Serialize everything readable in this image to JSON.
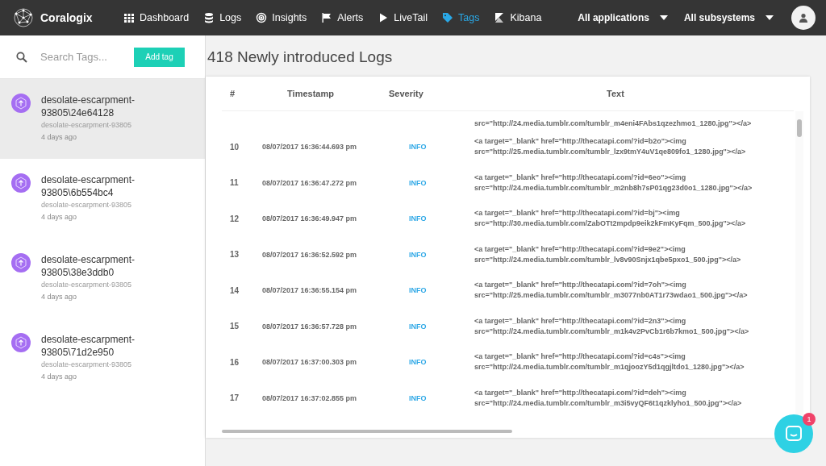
{
  "brand": "Coralogix",
  "nav": [
    {
      "label": "Dashboard",
      "selected": false
    },
    {
      "label": "Logs",
      "selected": false
    },
    {
      "label": "Insights",
      "selected": false
    },
    {
      "label": "Alerts",
      "selected": false
    },
    {
      "label": "LiveTail",
      "selected": false
    },
    {
      "label": "Tags",
      "selected": true
    },
    {
      "label": "Kibana",
      "selected": false
    }
  ],
  "filters": [
    "All applications",
    "All subsystems"
  ],
  "search": {
    "placeholder": "Search Tags..."
  },
  "add_button": "Add tag",
  "tags": [
    {
      "name": "desolate-escarpment-93805\\24e64128",
      "app": "desolate-escarpment-93805",
      "time": "4 days ago",
      "selected": true
    },
    {
      "name": "desolate-escarpment-93805\\6b554bc4",
      "app": "desolate-escarpment-93805",
      "time": "4 days ago",
      "selected": false
    },
    {
      "name": "desolate-escarpment-93805\\38e3ddb0",
      "app": "desolate-escarpment-93805",
      "time": "4 days ago",
      "selected": false
    },
    {
      "name": "desolate-escarpment-93805\\71d2e950",
      "app": "desolate-escarpment-93805",
      "time": "4 days ago",
      "selected": false
    }
  ],
  "title": "418 Newly introduced Logs",
  "table": {
    "columns": [
      "#",
      "Timestamp",
      "Severity",
      "Text"
    ],
    "rows": [
      {
        "text": [
          "src=\"http://24.media.tumblr.com/tumblr_m4eni4FAbs1qzezhmo1_1280.jpg\"></a>"
        ]
      },
      {
        "number": "10",
        "timestamp": "08/07/2017 16:36:44.693 pm",
        "severity": "INFO",
        "text": [
          "<a target=\"_blank\" href=\"http://thecatapi.com/?id=b2o\"><img",
          "src=\"http://25.media.tumblr.com/tumblr_lzx9tmY4uV1qe809fo1_1280.jpg\"></a>"
        ]
      },
      {
        "number": "11",
        "timestamp": "08/07/2017 16:36:47.272 pm",
        "severity": "INFO",
        "text": [
          "<a target=\"_blank\" href=\"http://thecatapi.com/?id=6eo\"><img",
          "src=\"http://24.media.tumblr.com/tumblr_m2nb8h7sP01qg23d0o1_1280.jpg\"></a>"
        ]
      },
      {
        "number": "12",
        "timestamp": "08/07/2017 16:36:49.947 pm",
        "severity": "INFO",
        "text": [
          "<a target=\"_blank\" href=\"http://thecatapi.com/?id=bj\"><img",
          "src=\"http://30.media.tumblr.com/ZabOTt2mpdp9eik2kFmKyFqm_500.jpg\"></a>"
        ]
      },
      {
        "number": "13",
        "timestamp": "08/07/2017 16:36:52.592 pm",
        "severity": "INFO",
        "text": [
          "<a target=\"_blank\" href=\"http://thecatapi.com/?id=9e2\"><img",
          "src=\"http://24.media.tumblr.com/tumblr_lv8v90Snjx1qbe5pxo1_500.jpg\"></a>"
        ]
      },
      {
        "number": "14",
        "timestamp": "08/07/2017 16:36:55.154 pm",
        "severity": "INFO",
        "text": [
          "<a target=\"_blank\" href=\"http://thecatapi.com/?id=7oh\"><img",
          "src=\"http://25.media.tumblr.com/tumblr_m3077nb0AT1r73wdao1_500.jpg\"></a>"
        ]
      },
      {
        "number": "15",
        "timestamp": "08/07/2017 16:36:57.728 pm",
        "severity": "INFO",
        "text": [
          "<a target=\"_blank\" href=\"http://thecatapi.com/?id=2n3\"><img",
          "src=\"http://24.media.tumblr.com/tumblr_m1k4v2PvCb1r6b7kmo1_500.jpg\"></a>"
        ]
      },
      {
        "number": "16",
        "timestamp": "08/07/2017 16:37:00.303 pm",
        "severity": "INFO",
        "text": [
          "<a target=\"_blank\" href=\"http://thecatapi.com/?id=c4s\"><img",
          "src=\"http://24.media.tumblr.com/tumblr_m1qjoozY5d1qgjltdo1_1280.jpg\"></a>"
        ]
      },
      {
        "number": "17",
        "timestamp": "08/07/2017 16:37:02.855 pm",
        "severity": "INFO",
        "text": [
          "<a target=\"_blank\" href=\"http://thecatapi.com/?id=deh\"><img",
          "src=\"http://24.media.tumblr.com/tumblr_m3i5vyQF6t1qzklyho1_500.jpg\"></a>"
        ]
      }
    ]
  },
  "chat": {
    "badge": "1"
  }
}
